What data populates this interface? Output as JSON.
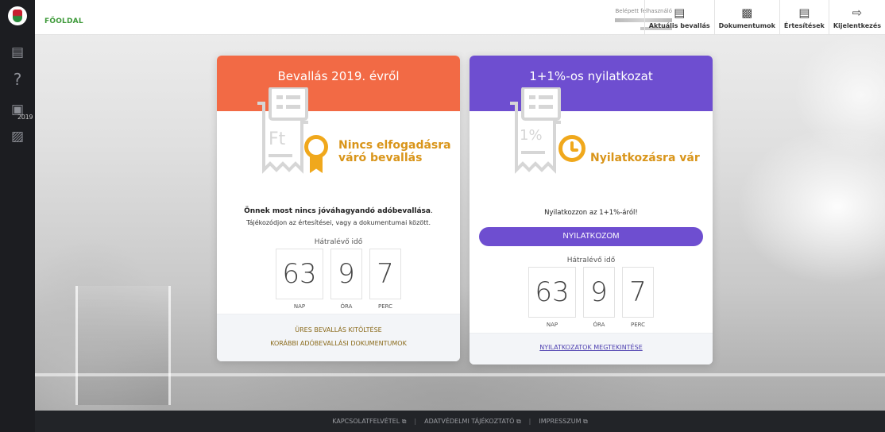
{
  "sidebar": {
    "year_badge": "2019"
  },
  "topbar": {
    "home": "FŐOLDAL",
    "user_label": "Belépett felhasználó",
    "nav": [
      {
        "label": "Aktuális bevallás",
        "icon": "document-search-icon"
      },
      {
        "label": "Dokumentumok",
        "icon": "documents-icon"
      },
      {
        "label": "Értesítések",
        "icon": "notification-icon"
      },
      {
        "label": "Kijelentkezés",
        "icon": "logout-icon"
      }
    ]
  },
  "card_tax": {
    "title": "Bevallás 2019. évről",
    "status": "Nincs elfogadásra váró bevallás",
    "info_bold": "Önnek most nincs jóváhagyandó adóbevallása",
    "info_rest": ".",
    "info_sub": "Tájékozódjon az értesítései, vagy a dokumentumai között.",
    "remaining_label": "Hátralévő idő",
    "days": "63",
    "hours": "9",
    "minutes": "7",
    "unit_days": "NAP",
    "unit_hours": "ÓRA",
    "unit_minutes": "PERC",
    "link1": "ÜRES BEVALLÁS KITÖLTÉSE",
    "link2": "KORÁBBI ADÓBEVALLÁSI DOKUMENTUMOK",
    "accent": "#f26a45"
  },
  "card_pledge": {
    "title": "1+1%-os nyilatkozat",
    "status": "Nyilatkozásra vár",
    "info": "Nyilatkozzon az 1+1%-áról!",
    "button": "NYILATKOZOM",
    "remaining_label": "Hátralévő idő",
    "days": "63",
    "hours": "9",
    "minutes": "7",
    "unit_days": "NAP",
    "unit_hours": "ÓRA",
    "unit_minutes": "PERC",
    "link": "NYILATKOZATOK MEGTEKINTÉSE",
    "accent": "#6e4ed0"
  },
  "footer": {
    "links": [
      "KAPCSOLATFELVÉTEL",
      "ADATVÉDELMI TÁJÉKOZTATÓ",
      "IMPRESSZUM"
    ],
    "separator": "|"
  }
}
